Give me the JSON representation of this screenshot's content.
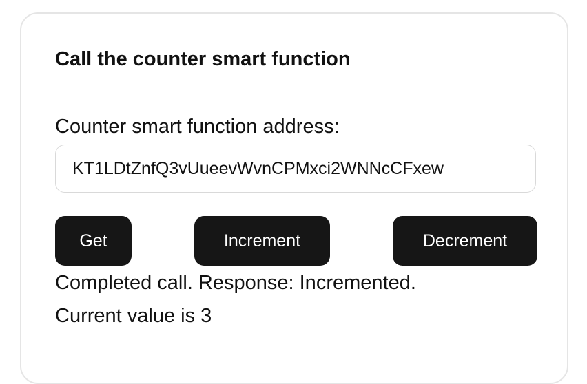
{
  "panel": {
    "title": "Call the counter smart function",
    "address_label": "Counter smart function address:",
    "address_value": "KT1LDtZnfQ3vUueevWvnCPMxci2WNNcCFxew"
  },
  "actions": {
    "get_label": "Get",
    "increment_label": "Increment",
    "decrement_label": "Decrement"
  },
  "status": {
    "response_text": "Completed call. Response: Incremented.",
    "current_value_text": "Current value is 3"
  },
  "colors": {
    "button_bg": "#161616",
    "button_text": "#ffffff",
    "border": "#e5e5e5"
  }
}
